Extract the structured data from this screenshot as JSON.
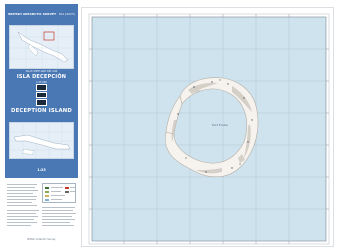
{
  "cover": {
    "publisher": "BRITISH ANTARCTIC SURVEY",
    "series_small": "BAS (UKAHT)",
    "series": "",
    "region": "ISLAS SHETLAND DEL SUR",
    "title_es": "ISLA DECEPCIÓN",
    "title_en": "DECEPTION ISLAND",
    "scale_label": "1:25 000",
    "code": "1:25"
  },
  "map": {
    "caldera_label": "Port Foster",
    "colors": {
      "sea": "#cfe3ef",
      "land": "#f6f3ee",
      "shade": "#c9c3bb",
      "grid": "#9aa7b5",
      "cover_blue": "#4a78b4"
    }
  },
  "backpanel": {
    "credit": "British Antarctic Survey"
  }
}
